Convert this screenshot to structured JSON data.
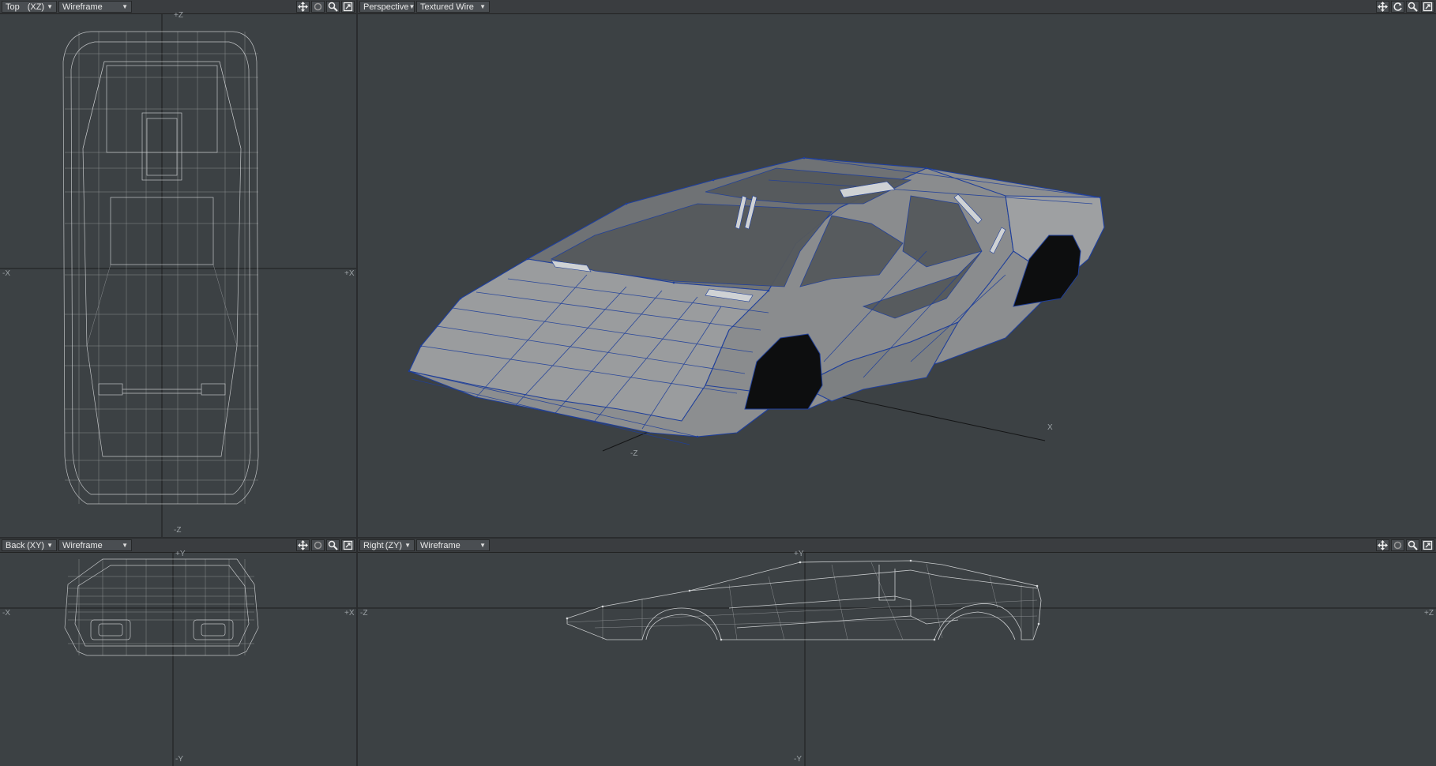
{
  "viewports": {
    "top": {
      "view": "Top",
      "plane": "(XZ)",
      "mode": "Wireframe",
      "axis": {
        "top": "+Z",
        "bottom": "-Z",
        "left": "-X",
        "right": "+X"
      }
    },
    "perspective": {
      "view": "Perspective",
      "mode": "Textured Wire",
      "axis": {
        "x": "X",
        "z": "-Z"
      }
    },
    "back": {
      "view": "Back",
      "plane": "(XY)",
      "mode": "Wireframe",
      "axis": {
        "top": "+Y",
        "left": "-X",
        "right": "+X",
        "bottom": "-Y"
      }
    },
    "right": {
      "view": "Right",
      "plane": "(ZY)",
      "mode": "Wireframe",
      "axis": {
        "top": "+Y",
        "left": "-Z",
        "right": "+Z",
        "bottom": "-Y"
      }
    }
  },
  "icons": [
    "move-icon",
    "rotate-icon",
    "zoom-icon",
    "maximize-icon"
  ],
  "colors": {
    "viewport_bg": "#3c4144",
    "wire": "#d8dadc",
    "blue_wire": "#1f3f9a",
    "surface": "#8a8c8e"
  }
}
